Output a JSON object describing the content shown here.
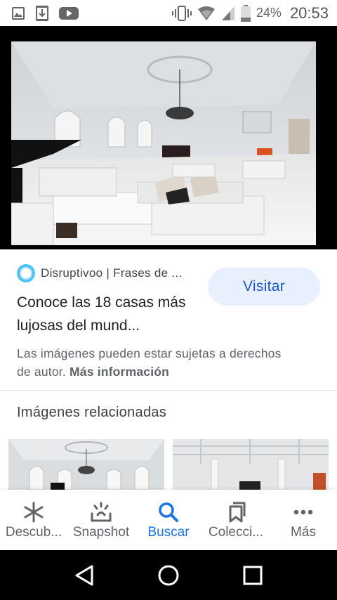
{
  "status_bar": {
    "battery_percent": "24%",
    "time": "20:53",
    "icons": [
      "gallery-icon",
      "download-icon",
      "youtube-icon",
      "vibrate-icon",
      "wifi-icon",
      "signal-icon",
      "battery-icon"
    ]
  },
  "result": {
    "site_name": "Disruptivoo | Frases de ...",
    "title": "Conoce las 18 casas más lujosas del mund...",
    "visit_label": "Visitar",
    "copyright_text": "Las imágenes pueden estar sujetas a derechos de autor.",
    "more_info_label": "Más información"
  },
  "related": {
    "heading": "Imágenes relacionadas"
  },
  "bottom_nav": {
    "items": [
      {
        "label": "Descub...",
        "icon": "asterisk-icon"
      },
      {
        "label": "Snapshot",
        "icon": "snapshot-icon"
      },
      {
        "label": "Buscar",
        "icon": "search-icon",
        "active": true
      },
      {
        "label": "Colecci...",
        "icon": "bookmarks-icon"
      },
      {
        "label": "Más",
        "icon": "more-dots-icon"
      }
    ]
  },
  "colors": {
    "accent": "#1a73e8",
    "visit_bg": "#e8f0fe"
  }
}
